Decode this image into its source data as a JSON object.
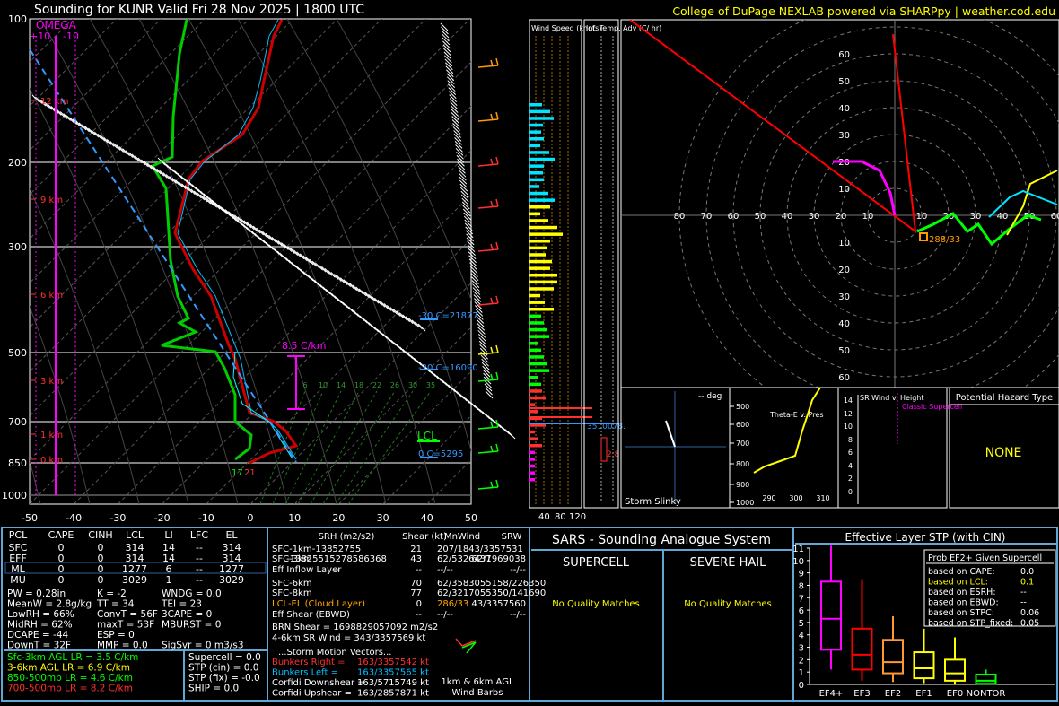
{
  "header": {
    "title": "Sounding for KUNR Valid  Fri 28 Nov 2025 | 1800 UTC",
    "credit": "College of DuPage NEXLAB powered via SHARPpy | weather.cod.edu"
  },
  "skewt": {
    "pressure_ticks": [
      "100",
      "200",
      "300",
      "500",
      "700",
      "850",
      "1000"
    ],
    "temp_ticks": [
      "-50",
      "-40",
      "-30",
      "-20",
      "-10",
      "0",
      "10",
      "20",
      "30",
      "40",
      "50"
    ],
    "height_labels": [
      "12 km",
      "9 km",
      "6 km",
      "3 km",
      "1 km",
      "0 km"
    ],
    "omega": {
      "title": "OMEGA",
      "left": "+10",
      "right": "-10"
    },
    "lapse_label": "8.5 C/km",
    "isotherm_labels": [
      {
        "text": "-30 C=21877"
      },
      {
        "text": "-20 C=16090"
      },
      {
        "text": "0 C=5295"
      }
    ],
    "lcl_label": "LCL",
    "surface_temp": "21",
    "surface_dew": "17",
    "mix_labels": [
      "6",
      "10",
      "14",
      "18",
      "22",
      "26",
      "30",
      "35"
    ],
    "side_label": "3510078.",
    "side_val": "2.8"
  },
  "wind_panel": {
    "title": "Wind Speed (knots)",
    "ticks": [
      "40",
      "80",
      "120"
    ]
  },
  "adv_panel": {
    "title": "Inf. Temp. Adv (C/ hr)"
  },
  "hodograph": {
    "rings": [
      "10",
      "20",
      "30",
      "40",
      "50",
      "60",
      "70",
      "80"
    ],
    "ring_labels_y": [
      "60",
      "50",
      "40",
      "30",
      "20",
      "10",
      "10",
      "20",
      "30",
      "40",
      "50",
      "60"
    ],
    "storm_label": "288/33"
  },
  "slinky": {
    "title": "Storm Slinky",
    "deg": "-- deg"
  },
  "thetae": {
    "title": "Theta-E v. Pres",
    "p_ticks": [
      "500",
      "600",
      "700",
      "800",
      "900",
      "1000"
    ],
    "t_ticks": [
      "290",
      "300",
      "310"
    ]
  },
  "srwind": {
    "title": "SR Wind v. Height",
    "class": "Classic Supercell",
    "h_ticks": [
      "14",
      "12",
      "10",
      "8",
      "6",
      "4",
      "2",
      "0"
    ]
  },
  "hazard": {
    "title": "Potential Hazard Type",
    "value": "NONE"
  },
  "parcels": {
    "headers": [
      "PCL",
      "CAPE",
      "CINH",
      "LCL",
      "LI",
      "LFC",
      "EL"
    ],
    "rows": [
      [
        "SFC",
        "0",
        "0",
        "314",
        "14",
        "--",
        "314"
      ],
      [
        "EFF",
        "0",
        "0",
        "314",
        "14",
        "--",
        "314"
      ],
      [
        "ML",
        "0",
        "0",
        "1277",
        "6",
        "--",
        "1277"
      ],
      [
        "MU",
        "0",
        "0",
        "3029",
        "1",
        "--",
        "3029"
      ]
    ]
  },
  "indices": {
    "col1": [
      "PW = 0.28in",
      "MeanW = 2.8g/kg",
      "LowRH = 66%",
      "MidRH = 62%",
      "DCAPE = -44",
      "DownT = 32F"
    ],
    "col2": [
      "K = -2",
      "TT = 34",
      "ConvT = 56F",
      "maxT = 53F",
      "ESP = 0",
      "MMP = 0.0"
    ],
    "col3": [
      "WNDG = 0.0",
      "TEI = 23",
      "3CAPE = 0",
      "MBURST = 0",
      "",
      "SigSvr = 0 m3/s3"
    ]
  },
  "lapse": [
    {
      "text": "Sfc-3km AGL LR = 3.5 C/km",
      "color": "#00ff00"
    },
    {
      "text": "3-6km AGL LR = 6.9 C/km",
      "color": "#ffff00"
    },
    {
      "text": "850-500mb LR = 4.6 C/km",
      "color": "#00ff00"
    },
    {
      "text": "700-500mb LR = 8.2 C/km",
      "color": "#ff3030"
    }
  ],
  "composite": [
    "Supercell = 0.0",
    "STP (cin) = 0.0",
    "STP (fix) = -0.0",
    "SHIP = 0.0"
  ],
  "kinematics": {
    "headers": [
      "SRH (m2/s2)",
      "Shear (kt)",
      "MnWind",
      "SRW"
    ],
    "rows": [
      {
        "label": "SFC-1km",
        "srh": "-13852755",
        "shear": "21",
        "mn": "207/1843/3357531",
        "srw": ""
      },
      {
        "label": "SFC-3km",
        "srh": "-13825515278586368",
        "shear": "43",
        "mn": "62/5326437",
        "srw": "62/1969038"
      },
      {
        "label": "Eff Inflow Layer",
        "srh": "--",
        "shear": "--",
        "mn": "--/--",
        "srw": "--/--"
      },
      {
        "label": "SFC-6km",
        "srh": "",
        "shear": "70",
        "mn": "62/3583055158/226350",
        "srw": ""
      },
      {
        "label": "SFC-8km",
        "srh": "",
        "shear": "77",
        "mn": "62/3217055350/141690",
        "srw": ""
      },
      {
        "label": "LCL-EL (Cloud Layer)",
        "srh": "",
        "shear": "0",
        "mn": "286/33",
        "srw": "43/3357560"
      },
      {
        "label": "Eff Shear (EBWD)",
        "srh": "",
        "shear": "--",
        "mn": "--/--",
        "srw": "--/--"
      }
    ],
    "brn": "BRN Shear = 1698829057092 m2/s2",
    "srwind": "4-6km SR Wind =    343/3357569 kt",
    "storm_title": "...Storm Motion Vectors...",
    "motions": [
      {
        "label": "Bunkers Right =",
        "value": "163/3357542 kt",
        "color": "#ff3030"
      },
      {
        "label": "Bunkers Left =",
        "value": "163/3357565 kt",
        "color": "#00bfff"
      },
      {
        "label": "Corfidi Downshear =",
        "value": "163/5715749 kt",
        "color": "#ffffff"
      },
      {
        "label": "Corfidi Upshear =",
        "value": "163/2857871 kt",
        "color": "#ffffff"
      }
    ],
    "barb_caption": "1km & 6km AGL Wind Barbs"
  },
  "sars": {
    "title": "SARS - Sounding Analogue System",
    "supercell": "SUPERCELL",
    "hail": "SEVERE HAIL",
    "s_match": "No Quality Matches",
    "h_match": "No Quality Matches"
  },
  "stp": {
    "title": "Effective Layer STP (with CIN)",
    "legend_title": "Prob EF2+ Given Supercell",
    "legend": [
      [
        "based on CAPE:",
        "0.0"
      ],
      [
        "based on LCL:",
        "0.1"
      ],
      [
        "based on ESRH:",
        "--"
      ],
      [
        "based on EBWD:",
        "--"
      ],
      [
        "based on STPC:",
        "0.06"
      ],
      [
        "based on STP_fixed:",
        "0.05"
      ]
    ],
    "y_ticks": [
      "11",
      "10",
      "9",
      "8",
      "7",
      "6",
      "5",
      "4",
      "3",
      "2",
      "1",
      "0"
    ]
  },
  "chart_data": {
    "type": "box",
    "title": "Effective Layer STP (with CIN)",
    "categories": [
      "EF4+",
      "EF3",
      "EF2",
      "EF1",
      "EF0",
      "NONTOR"
    ],
    "colors": [
      "#ff00ff",
      "#ff0000",
      "#ff9933",
      "#ffff00",
      "#ffff00",
      "#00ff00"
    ],
    "boxes": [
      {
        "whislo": 1.2,
        "q1": 2.8,
        "med": 5.3,
        "q3": 8.3,
        "whishi": 11.2
      },
      {
        "whislo": 0.3,
        "q1": 1.2,
        "med": 2.4,
        "q3": 4.5,
        "whishi": 8.5
      },
      {
        "whislo": 0.2,
        "q1": 0.9,
        "med": 1.8,
        "q3": 3.6,
        "whishi": 5.5
      },
      {
        "whislo": 0.1,
        "q1": 0.5,
        "med": 1.3,
        "q3": 2.6,
        "whishi": 4.5
      },
      {
        "whislo": 0.0,
        "q1": 0.3,
        "med": 0.9,
        "q3": 2.0,
        "whishi": 3.8
      },
      {
        "whislo": 0.0,
        "q1": 0.05,
        "med": 0.3,
        "q3": 0.8,
        "whishi": 1.2
      }
    ],
    "ylim": [
      0,
      11
    ],
    "stp_cin": 0.0
  },
  "colors": {
    "temp": "#cc0000",
    "dew": "#00cc00",
    "virt": "#00bfff",
    "wetbulb": "#00ffff",
    "frame": "#5fa8d3"
  }
}
